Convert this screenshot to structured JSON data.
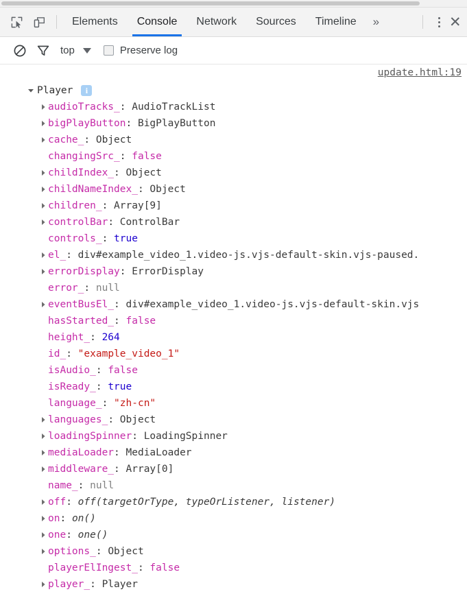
{
  "window": {
    "app": "Chrome DevTools"
  },
  "toolbar": {
    "inspect_icon": "inspect-element-icon",
    "device_icon": "device-toolbar-icon",
    "overflow_label": "»",
    "menu_icon": "more-options-icon",
    "close_label": "✕",
    "tabs": [
      {
        "label": "Elements",
        "active": false
      },
      {
        "label": "Console",
        "active": true
      },
      {
        "label": "Network",
        "active": false
      },
      {
        "label": "Sources",
        "active": false
      },
      {
        "label": "Timeline",
        "active": false
      }
    ],
    "active_tab": "Console",
    "accent_color": "#1a73e8"
  },
  "options_bar": {
    "clear_icon": "clear-console-icon",
    "filter_icon": "filter-icon",
    "context": "top",
    "context_caret": "chevron-down-icon",
    "preserve_log_label": "Preserve log",
    "preserve_log_checked": false
  },
  "console": {
    "source_link": "update.html:19",
    "root": {
      "name": "Player",
      "expanded": true,
      "badge": "i"
    },
    "properties": [
      {
        "expandable": true,
        "name": "audioTracks_",
        "sep": ": ",
        "value": "AudioTrackList",
        "type": "obj"
      },
      {
        "expandable": true,
        "name": "bigPlayButton",
        "sep": ": ",
        "value": "BigPlayButton",
        "type": "obj"
      },
      {
        "expandable": true,
        "name": "cache_",
        "sep": ": ",
        "value": "Object",
        "type": "obj"
      },
      {
        "expandable": false,
        "name": "changingSrc_",
        "sep": ": ",
        "value": "false",
        "type": "false"
      },
      {
        "expandable": true,
        "name": "childIndex_",
        "sep": ": ",
        "value": "Object",
        "type": "obj"
      },
      {
        "expandable": true,
        "name": "childNameIndex_",
        "sep": ": ",
        "value": "Object",
        "type": "obj"
      },
      {
        "expandable": true,
        "name": "children_",
        "sep": ": ",
        "value": "Array[9]",
        "type": "obj"
      },
      {
        "expandable": true,
        "name": "controlBar",
        "sep": ": ",
        "value": "ControlBar",
        "type": "obj"
      },
      {
        "expandable": false,
        "name": "controls_",
        "sep": ": ",
        "value": "true",
        "type": "true"
      },
      {
        "expandable": true,
        "name": "el_",
        "sep": ": ",
        "value": "div#example_video_1.video-js.vjs-default-skin.vjs-paused.",
        "type": "obj"
      },
      {
        "expandable": true,
        "name": "errorDisplay",
        "sep": ": ",
        "value": "ErrorDisplay",
        "type": "obj"
      },
      {
        "expandable": false,
        "name": "error_",
        "sep": ": ",
        "value": "null",
        "type": "null"
      },
      {
        "expandable": true,
        "name": "eventBusEl_",
        "sep": ": ",
        "value": "div#example_video_1.video-js.vjs-default-skin.vjs",
        "type": "obj"
      },
      {
        "expandable": false,
        "name": "hasStarted_",
        "sep": ": ",
        "value": "false",
        "type": "false"
      },
      {
        "expandable": false,
        "name": "height_",
        "sep": ": ",
        "value": "264",
        "type": "num"
      },
      {
        "expandable": false,
        "name": "id_",
        "sep": ": ",
        "value": "\"example_video_1\"",
        "type": "str"
      },
      {
        "expandable": false,
        "name": "isAudio_",
        "sep": ": ",
        "value": "false",
        "type": "false"
      },
      {
        "expandable": false,
        "name": "isReady_",
        "sep": ": ",
        "value": "true",
        "type": "true"
      },
      {
        "expandable": false,
        "name": "language_",
        "sep": ": ",
        "value": "\"zh-cn\"",
        "type": "str"
      },
      {
        "expandable": true,
        "name": "languages_",
        "sep": ": ",
        "value": "Object",
        "type": "obj"
      },
      {
        "expandable": true,
        "name": "loadingSpinner",
        "sep": ": ",
        "value": "LoadingSpinner",
        "type": "obj"
      },
      {
        "expandable": true,
        "name": "mediaLoader",
        "sep": ": ",
        "value": "MediaLoader",
        "type": "obj"
      },
      {
        "expandable": true,
        "name": "middleware_",
        "sep": ": ",
        "value": "Array[0]",
        "type": "obj"
      },
      {
        "expandable": false,
        "name": "name_",
        "sep": ": ",
        "value": "null",
        "type": "null"
      },
      {
        "expandable": true,
        "name": "off",
        "sep": ": ",
        "value": "off(targetOrType, typeOrListener, listener)",
        "type": "fn"
      },
      {
        "expandable": true,
        "name": "on",
        "sep": ": ",
        "value": "on()",
        "type": "fn"
      },
      {
        "expandable": true,
        "name": "one",
        "sep": ": ",
        "value": "one()",
        "type": "fn"
      },
      {
        "expandable": true,
        "name": "options_",
        "sep": ": ",
        "value": "Object",
        "type": "obj"
      },
      {
        "expandable": false,
        "name": "playerElIngest_",
        "sep": ": ",
        "value": "false",
        "type": "false"
      },
      {
        "expandable": true,
        "name": "player_",
        "sep": ": ",
        "value": "Player",
        "type": "obj"
      }
    ]
  }
}
